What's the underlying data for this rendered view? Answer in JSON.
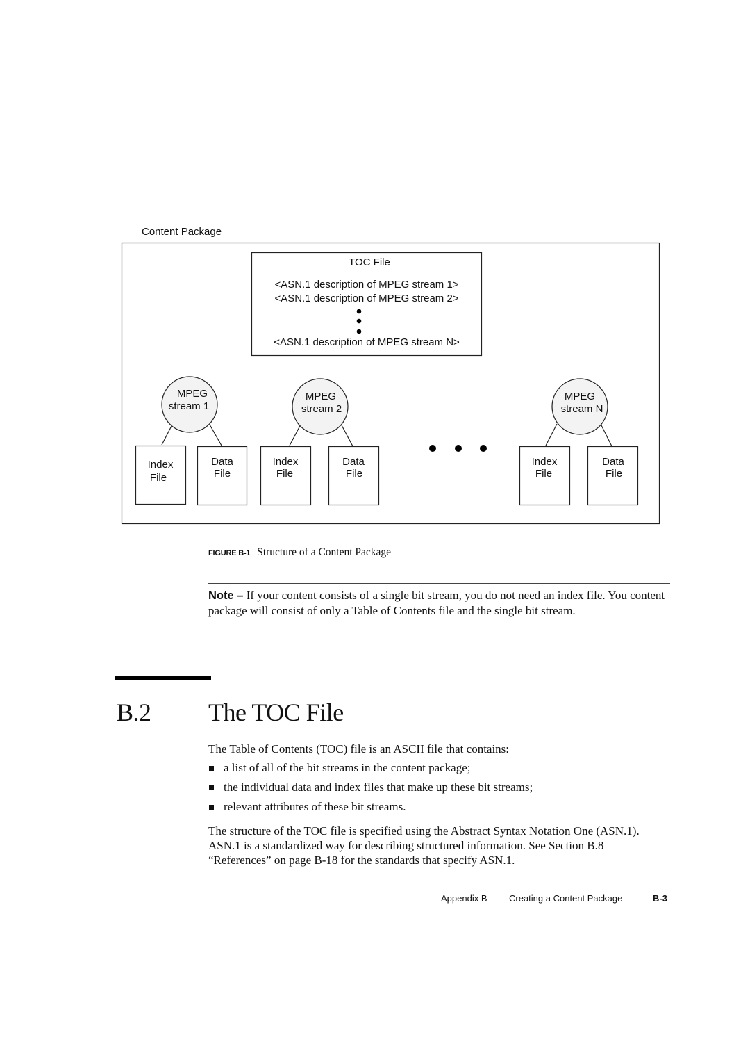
{
  "figure": {
    "package_label": "Content Package",
    "toc": {
      "title": "TOC File",
      "lines": [
        "<ASN.1 description of MPEG stream 1>",
        "<ASN.1 description of MPEG stream 2>",
        "<ASN.1 description of MPEG stream N>"
      ]
    },
    "streams": [
      {
        "line1": "MPEG",
        "line2": "stream 1",
        "index_l1": "Index",
        "index_l2": "File",
        "data_l1": "Data",
        "data_l2": "File"
      },
      {
        "line1": "MPEG",
        "line2": "stream 2",
        "index_l1": "Index",
        "index_l2": "File",
        "data_l1": "Data",
        "data_l2": "File"
      },
      {
        "line1": "MPEG",
        "line2": "stream N",
        "index_l1": "Index",
        "index_l2": "File",
        "data_l1": "Data",
        "data_l2": "File"
      }
    ],
    "caption_label": "FIGURE B-1",
    "caption_text": "Structure of a Content Package"
  },
  "note": {
    "label": "Note –",
    "text": " If your content consists of a single bit stream, you do not need an index file. You content package will consist of only a Table of Contents file and the single bit stream."
  },
  "section": {
    "number": "B.2",
    "title": "The TOC File",
    "intro": "The Table of Contents (TOC) file is an ASCII file that contains:",
    "bullets": [
      "a list of all of the bit streams in the content package;",
      "the individual data and index files that make up these bit streams;",
      "relevant attributes of these bit streams."
    ],
    "paragraph": "The structure of the TOC file is specified using the Abstract Syntax Notation One (ASN.1). ASN.1 is a standardized way for describing structured information. See Section B.8 “References” on page B-18 for the standards that specify ASN.1."
  },
  "footer": {
    "appendix": "Appendix B",
    "chapter": "Creating a Content Package",
    "page": "B-3"
  }
}
